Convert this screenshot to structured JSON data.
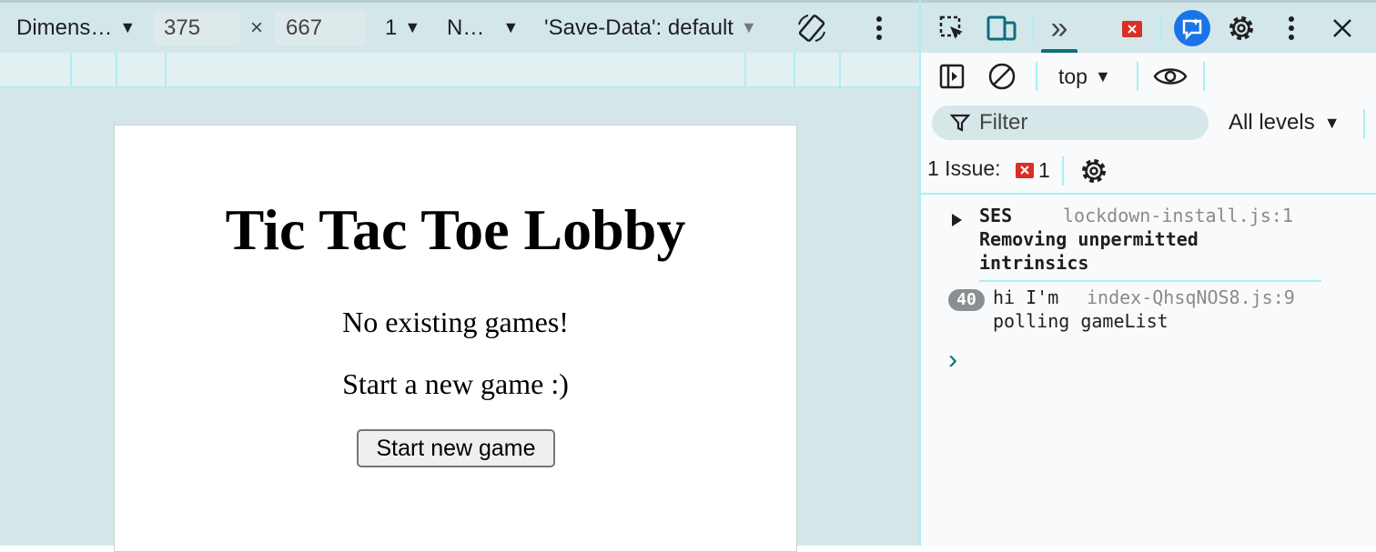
{
  "device_toolbar": {
    "dimensions_label": "Dimens…",
    "width_value": "375",
    "times_symbol": "×",
    "height_value": "667",
    "dpr_value": "1",
    "throttle_label": "N…",
    "save_data_label": "'Save-Data': default"
  },
  "page": {
    "title": "Tic Tac Toe Lobby",
    "no_games_text": "No existing games!",
    "start_text": "Start a new game :)",
    "start_button_label": "Start new game"
  },
  "devtools": {
    "more_tabs_glyph": "»",
    "context_label": "top",
    "filter_placeholder": "Filter",
    "levels_label": "All levels",
    "issues_label": "1 Issue:",
    "issues_count": "1",
    "messages": [
      {
        "title": "SES",
        "text_line1": "Removing unpermitted",
        "text_line2": "intrinsics",
        "source": "lockdown-install.js:1"
      },
      {
        "repeat_count": "40",
        "text_line1": "hi I'm",
        "text_line2": "polling gameList",
        "source": "index-QhsqNOS8.js:9"
      }
    ],
    "prompt_glyph": "›"
  },
  "colors": {
    "accent": "#0b6f7b",
    "error": "#d93025",
    "ai_blue": "#1a73e8"
  }
}
